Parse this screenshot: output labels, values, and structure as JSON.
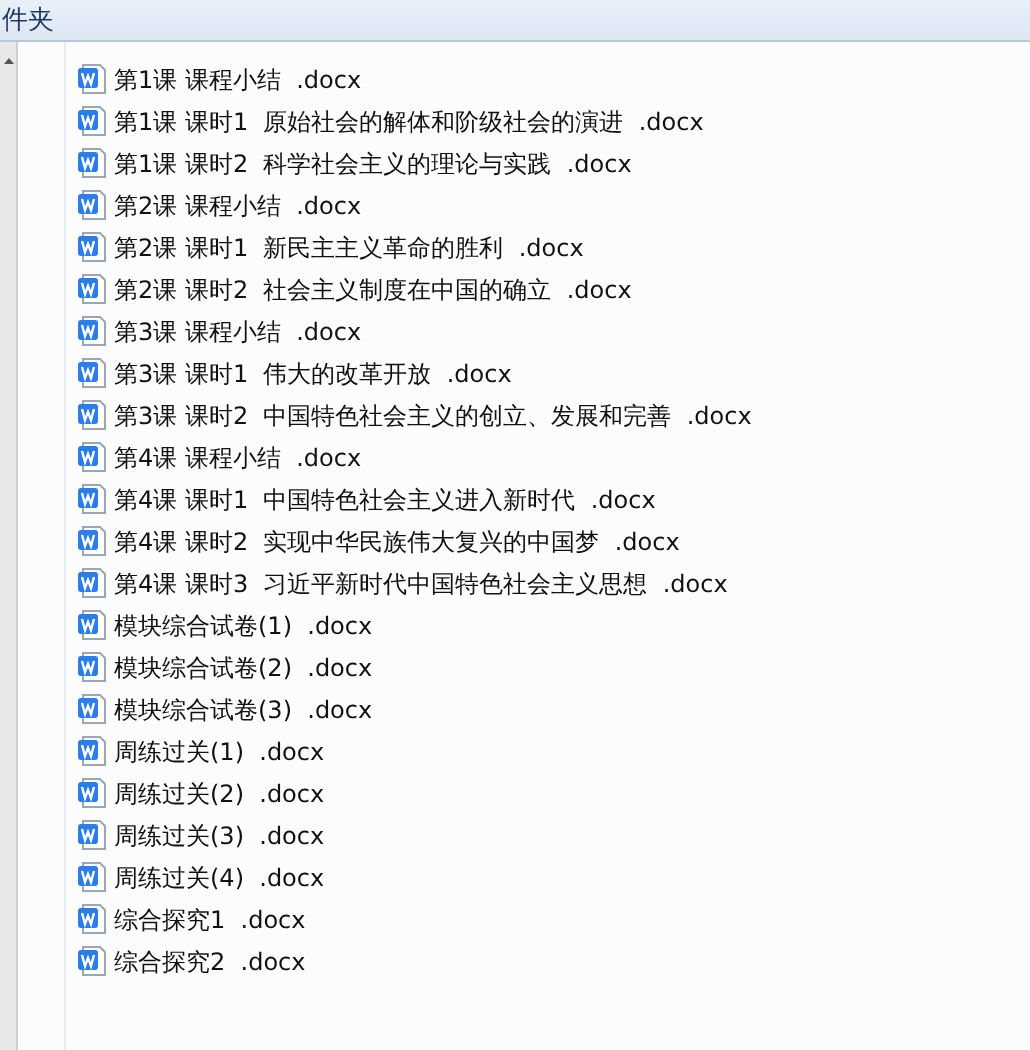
{
  "header": {
    "title": "件夹"
  },
  "files": [
    {
      "name": "第1课 课程小结  .docx"
    },
    {
      "name": "第1课 课时1  原始社会的解体和阶级社会的演进  .docx"
    },
    {
      "name": "第1课 课时2  科学社会主义的理论与实践  .docx"
    },
    {
      "name": "第2课 课程小结  .docx"
    },
    {
      "name": "第2课 课时1  新民主主义革命的胜利  .docx"
    },
    {
      "name": "第2课 课时2  社会主义制度在中国的确立  .docx"
    },
    {
      "name": "第3课 课程小结  .docx"
    },
    {
      "name": "第3课 课时1  伟大的改革开放  .docx"
    },
    {
      "name": "第3课 课时2  中国特色社会主义的创立、发展和完善  .docx"
    },
    {
      "name": "第4课 课程小结  .docx"
    },
    {
      "name": "第4课 课时1  中国特色社会主义进入新时代  .docx"
    },
    {
      "name": "第4课 课时2  实现中华民族伟大复兴的中国梦  .docx"
    },
    {
      "name": "第4课 课时3  习近平新时代中国特色社会主义思想  .docx"
    },
    {
      "name": "模块综合试卷(1)  .docx"
    },
    {
      "name": "模块综合试卷(2)  .docx"
    },
    {
      "name": "模块综合试卷(3)  .docx"
    },
    {
      "name": "周练过关(1)  .docx"
    },
    {
      "name": "周练过关(2)  .docx"
    },
    {
      "name": "周练过关(3)  .docx"
    },
    {
      "name": "周练过关(4)  .docx"
    },
    {
      "name": "综合探究1  .docx"
    },
    {
      "name": "综合探究2  .docx"
    }
  ]
}
